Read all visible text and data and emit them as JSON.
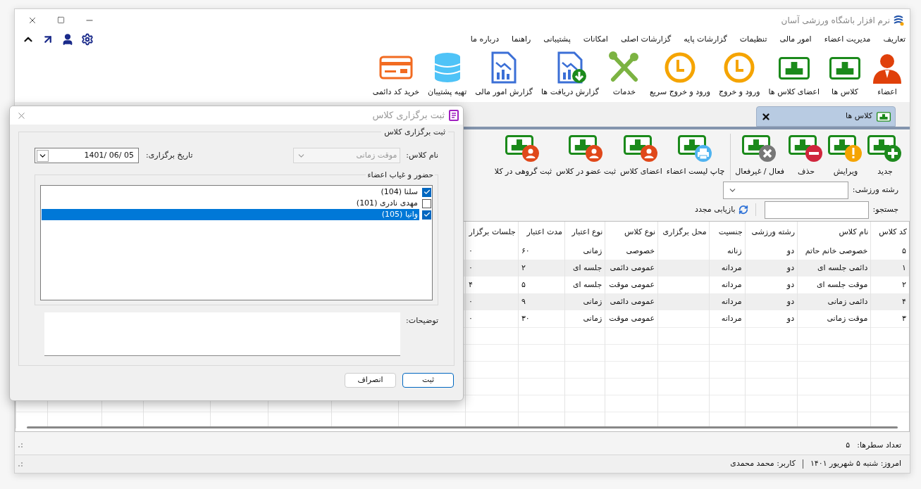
{
  "window": {
    "title": "نرم افزار باشگاه ورزشی آسان"
  },
  "menu": [
    "تعاریف",
    "مدیریت اعضاء",
    "امور مالی",
    "تنظیمات",
    "گزارشات پایه",
    "گزارشات اصلی",
    "امکانات",
    "پشتیبانی",
    "راهنما",
    "درباره ما"
  ],
  "ribbon": [
    {
      "label": "اعضاء",
      "kind": "person"
    },
    {
      "label": "کلاس ها",
      "kind": "board"
    },
    {
      "label": "اعضای کلاس ها",
      "kind": "board"
    },
    {
      "label": "ورود و خروج",
      "kind": "clock"
    },
    {
      "label": "ورود و خروج سریع",
      "kind": "clock"
    },
    {
      "label": "خدمات",
      "kind": "tools"
    },
    {
      "label": "گزارش دریافت ها",
      "kind": "report-download"
    },
    {
      "label": "گزارش امور مالی",
      "kind": "report"
    },
    {
      "label": "تهیه پشتیبان",
      "kind": "database"
    },
    {
      "label": "خرید کد دائمی",
      "kind": "card"
    }
  ],
  "tabs": [
    {
      "label": "کلاس ها",
      "selected": true
    }
  ],
  "toolbar": {
    "groups": [
      [
        {
          "label": "جدید",
          "kind": "add"
        },
        {
          "label": "ویرایش",
          "kind": "edit"
        },
        {
          "label": "حذف",
          "kind": "delete"
        },
        {
          "label": "فعال / غیرفعال",
          "kind": "toggle"
        }
      ],
      [
        {
          "label": "چاپ لیست اعضاء",
          "kind": "print"
        },
        {
          "label": "اعضای کلاس",
          "kind": "member"
        },
        {
          "label": "ثبت عضو در کلاس",
          "kind": "member"
        },
        {
          "label": "ثبت گروهی در کلا",
          "kind": "member"
        }
      ]
    ]
  },
  "filter": {
    "label": "رشته ورزشی:"
  },
  "search": {
    "label": "جستجو:",
    "refresh": "بازیابی مجدد"
  },
  "table": {
    "columns": [
      "کد کلاس",
      "نام کلاس",
      "رشته ورزشی",
      "جنسیت",
      "محل برگزاری",
      "نوع کلاس",
      "نوع اعتبار",
      "مدت اعتبار",
      "جلسات برگزار"
    ],
    "rows": [
      [
        "۵",
        "خصوصی خانم حاتم",
        "دو",
        "زنانه",
        null,
        "خصوصی",
        "زمانی",
        "۶۰",
        "۰"
      ],
      [
        "۱",
        "دائمی جلسه ای",
        "دو",
        "مردانه",
        null,
        "عمومی دائمی",
        "جلسه ای",
        "۲",
        "۰"
      ],
      [
        "۲",
        "موقت جلسه ای",
        "دو",
        "مردانه",
        null,
        "عمومی موقت",
        "جلسه ای",
        "۵",
        "۴"
      ],
      [
        "۴",
        "دائمی زمانی",
        "دو",
        "مردانه",
        null,
        "عمومی دائمی",
        "زمانی",
        "۹",
        "۰"
      ],
      [
        "۳",
        "موقت زمانی",
        "دو",
        "مردانه",
        null,
        "عمومی موقت",
        "زمانی",
        "۳۰",
        "۰"
      ]
    ]
  },
  "row_count": {
    "label": "تعداد سطرها:",
    "value": "۵"
  },
  "status_bar": {
    "date": "امروز: شنبه ۵ شهریور ۱۴۰۱",
    "user": "کاربر: محمد محمدی"
  },
  "dialog": {
    "title": "ثبت برگزاری کلاس",
    "group": "ثبت برگزاری کلاس",
    "class_name": {
      "label": "نام کلاس:",
      "value": "موقت زمانی",
      "disabled": true
    },
    "date": {
      "label": "تاریخ برگزاری:",
      "value": "1401/ 06/ 05"
    },
    "attendance": {
      "title": "حضور و غیاب اعضاء",
      "members": [
        {
          "label": "سلنا (104)",
          "checked": true,
          "selected": false
        },
        {
          "label": "مهدی نادری (101)",
          "checked": false,
          "selected": false
        },
        {
          "label": "وانیا (105)",
          "checked": true,
          "selected": true
        }
      ]
    },
    "notes": {
      "label": "توضیحات:"
    },
    "buttons": [
      {
        "label": "ثبت",
        "default": true
      },
      {
        "label": "انصراف",
        "default": false
      }
    ]
  }
}
